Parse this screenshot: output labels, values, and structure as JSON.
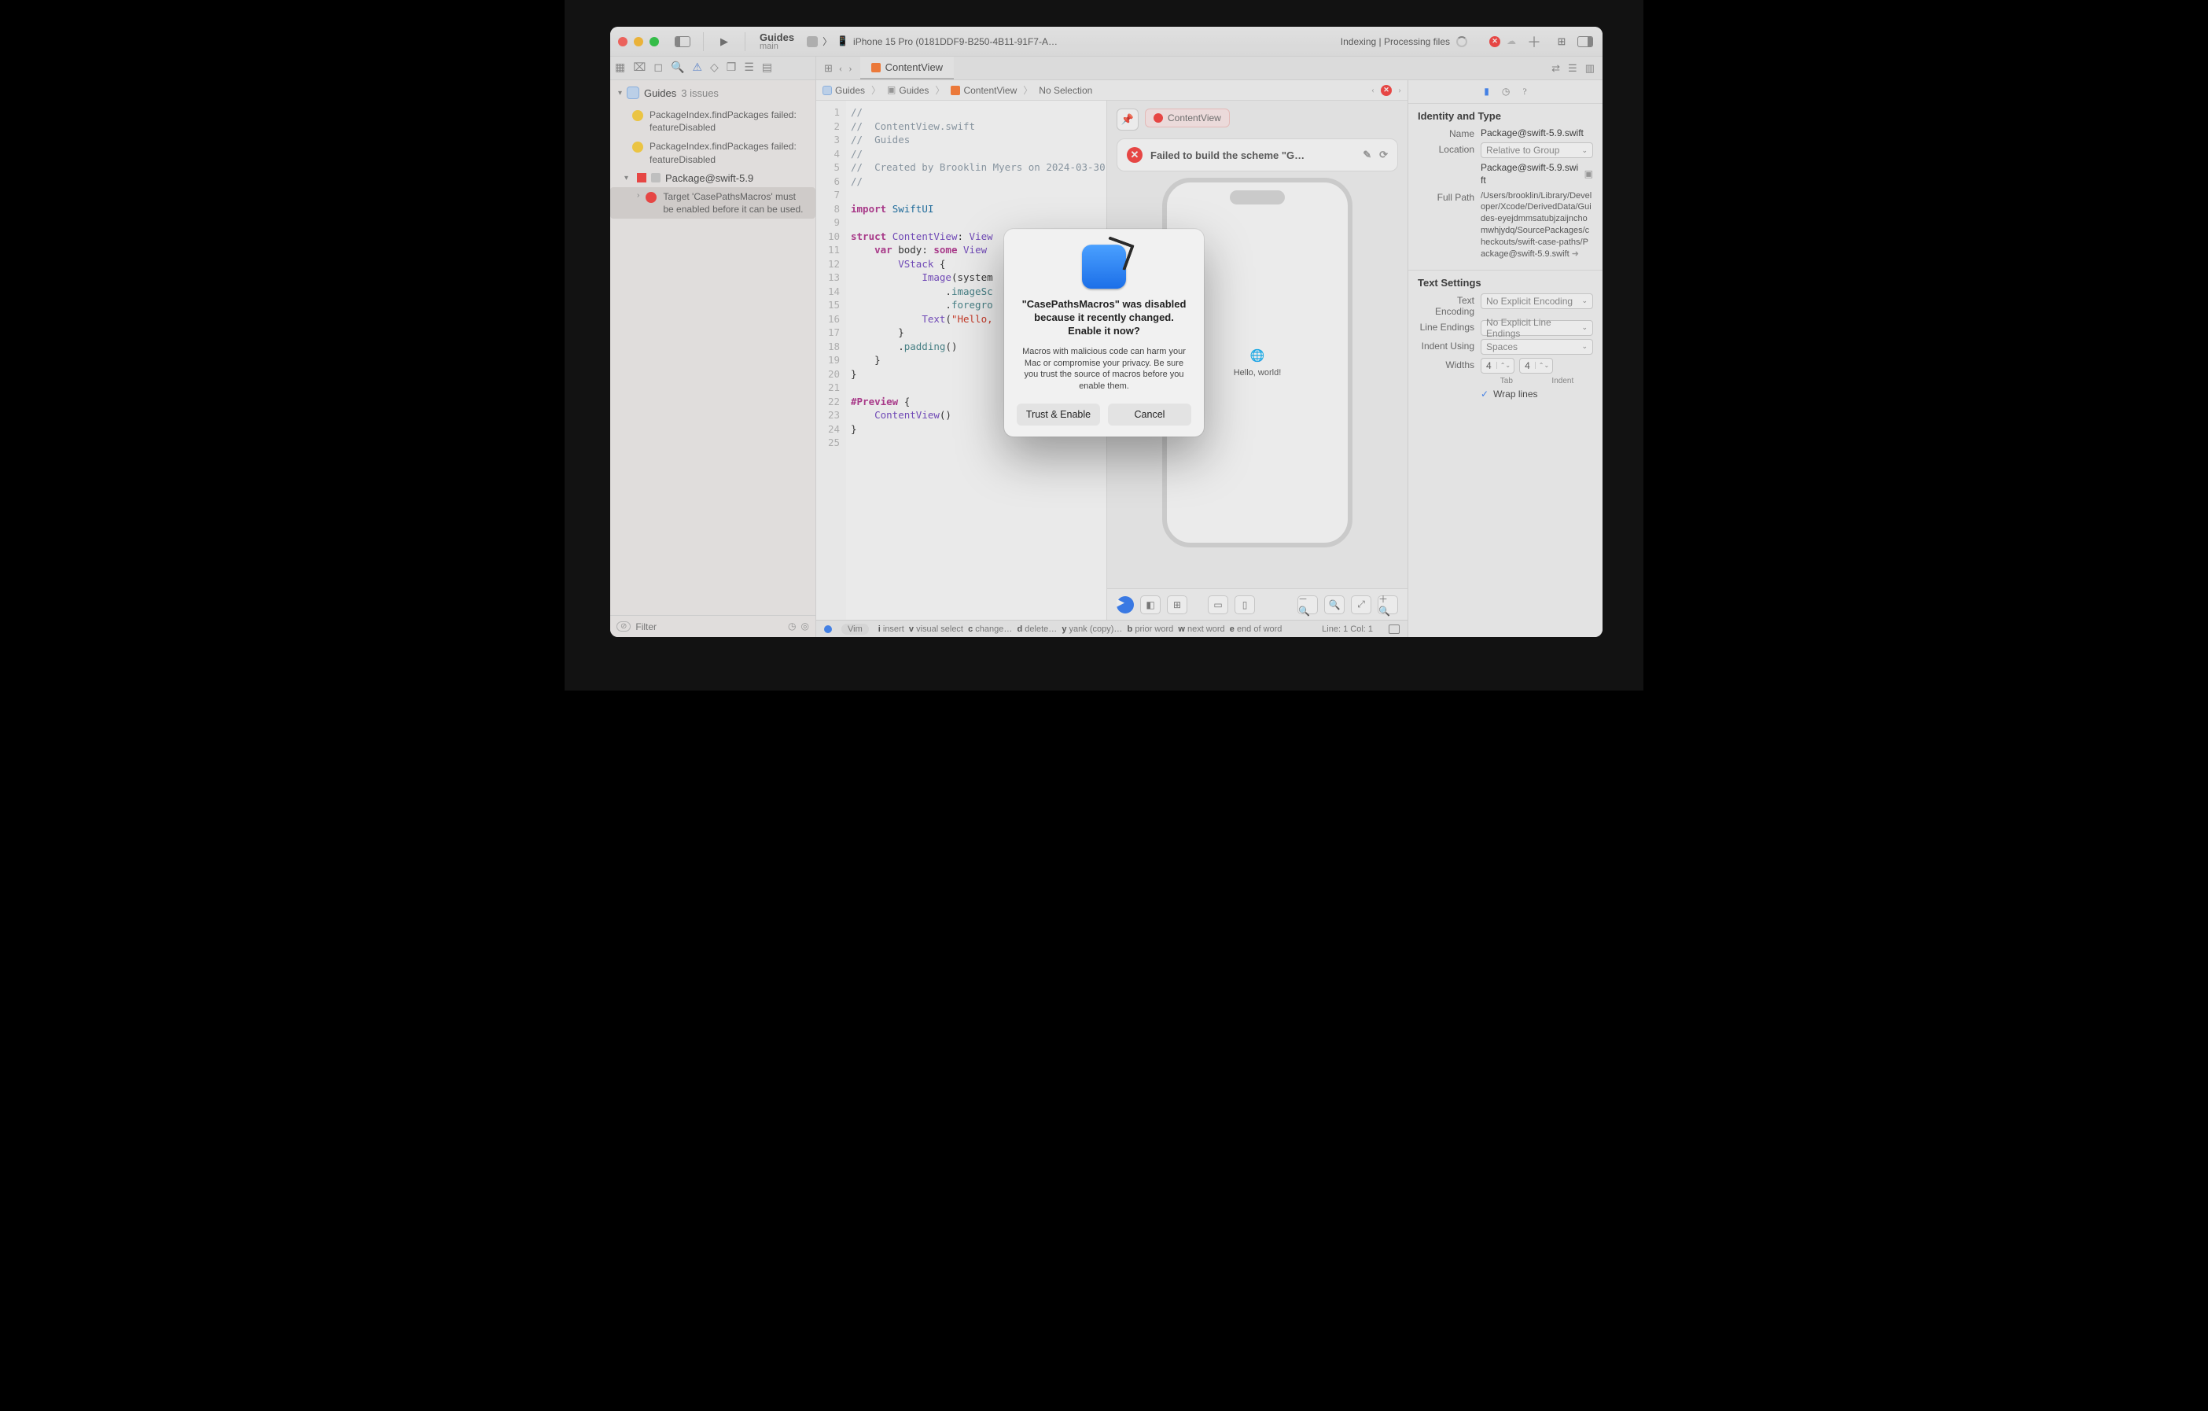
{
  "toolbar": {
    "scheme_name": "Guides",
    "branch": "main",
    "run_destination": "iPhone 15 Pro (0181DDF9-B250-4B11-91F7-A…",
    "activity": "Indexing | Processing files"
  },
  "navigator": {
    "project": "Guides",
    "issue_count": "3 issues",
    "warnings": [
      "PackageIndex.findPackages failed: featureDisabled",
      "PackageIndex.findPackages failed: featureDisabled"
    ],
    "package_row": "Package@swift-5.9",
    "error_item": "Target 'CasePathsMacros' must be enabled before it can be used.",
    "filter_placeholder": "Filter"
  },
  "tabbar": {
    "active_tab": "ContentView"
  },
  "jumpbar": {
    "crumbs": [
      "Guides",
      "Guides",
      "ContentView",
      "No Selection"
    ]
  },
  "code": {
    "lines": [
      {
        "n": 1,
        "html": "<span class=c-cmt>//</span>"
      },
      {
        "n": 2,
        "html": "<span class=c-cmt>//  ContentView.swift</span>"
      },
      {
        "n": 3,
        "html": "<span class=c-cmt>//  Guides</span>"
      },
      {
        "n": 4,
        "html": "<span class=c-cmt>//</span>"
      },
      {
        "n": 5,
        "html": "<span class=c-cmt>//  Created by Brooklin Myers on 2024-03-30.</span>"
      },
      {
        "n": 6,
        "html": "<span class=c-cmt>//</span>"
      },
      {
        "n": 7,
        "html": ""
      },
      {
        "n": 8,
        "html": "<span class=c-kw>import</span> <span class=c-id>SwiftUI</span>"
      },
      {
        "n": 9,
        "html": ""
      },
      {
        "n": 10,
        "html": "<span class=c-kw>struct</span> <span class=c-type>ContentView</span>: <span class=c-type>View</span>"
      },
      {
        "n": 11,
        "html": "    <span class=c-kw>var</span> body: <span class=c-kw>some</span> <span class=c-type>View</span>"
      },
      {
        "n": 12,
        "html": "        <span class=c-type>VStack</span> {"
      },
      {
        "n": 13,
        "html": "            <span class=c-type>Image</span>(system"
      },
      {
        "n": 14,
        "html": "                .<span class=c-func>imageSc</span>"
      },
      {
        "n": 15,
        "html": "                .<span class=c-func>foregro</span>"
      },
      {
        "n": 16,
        "html": "            <span class=c-type>Text</span>(<span class=c-str>\"Hello,</span>"
      },
      {
        "n": 17,
        "html": "        }"
      },
      {
        "n": 18,
        "html": "        .<span class=c-func>padding</span>()"
      },
      {
        "n": 19,
        "html": "    }"
      },
      {
        "n": 20,
        "html": "}"
      },
      {
        "n": 21,
        "html": ""
      },
      {
        "n": 22,
        "html": "<span class=c-kw>#Preview</span> {"
      },
      {
        "n": 23,
        "html": "    <span class=c-type>ContentView</span>()"
      },
      {
        "n": 24,
        "html": "}"
      },
      {
        "n": 25,
        "html": ""
      }
    ]
  },
  "canvas": {
    "chip_label": "ContentView",
    "build_fail": "Failed to build the scheme \"G…",
    "preview_text": "Hello, world!"
  },
  "inspector": {
    "identity_header": "Identity and Type",
    "name_label": "Name",
    "name_value": "Package@swift-5.9.swift",
    "location_label": "Location",
    "location_value": "Relative to Group",
    "location_file": "Package@swift-5.9.swift",
    "fullpath_label": "Full Path",
    "fullpath_value": "/Users/brooklin/Library/Developer/Xcode/DerivedData/Guides-eyejdmmsatubjzaijnchomwhjydq/SourcePackages/checkouts/swift-case-paths/Package@swift-5.9.swift",
    "text_header": "Text Settings",
    "enc_label": "Text Encoding",
    "enc_value": "No Explicit Encoding",
    "le_label": "Line Endings",
    "le_value": "No Explicit Line Endings",
    "indent_label": "Indent Using",
    "indent_value": "Spaces",
    "widths_label": "Widths",
    "tab_value": "4",
    "indentw_value": "4",
    "tab_caption": "Tab",
    "indent_caption": "Indent",
    "wrap_label": "Wrap lines"
  },
  "statusbar": {
    "mode": "Vim",
    "hints": [
      {
        "k": "i",
        "t": "insert"
      },
      {
        "k": "v",
        "t": "visual select"
      },
      {
        "k": "c",
        "t": "change…"
      },
      {
        "k": "d",
        "t": "delete…"
      },
      {
        "k": "y",
        "t": "yank (copy)…"
      },
      {
        "k": "b",
        "t": "prior word"
      },
      {
        "k": "w",
        "t": "next word"
      },
      {
        "k": "e",
        "t": "end of word"
      }
    ],
    "position": "Line: 1  Col: 1"
  },
  "dialog": {
    "title": "\"CasePathsMacros\" was disabled because it recently changed.\nEnable it now?",
    "body": "Macros with malicious code can harm your Mac or compromise your privacy. Be sure you trust the source of macros before you enable them.",
    "primary": "Trust & Enable",
    "secondary": "Cancel"
  }
}
